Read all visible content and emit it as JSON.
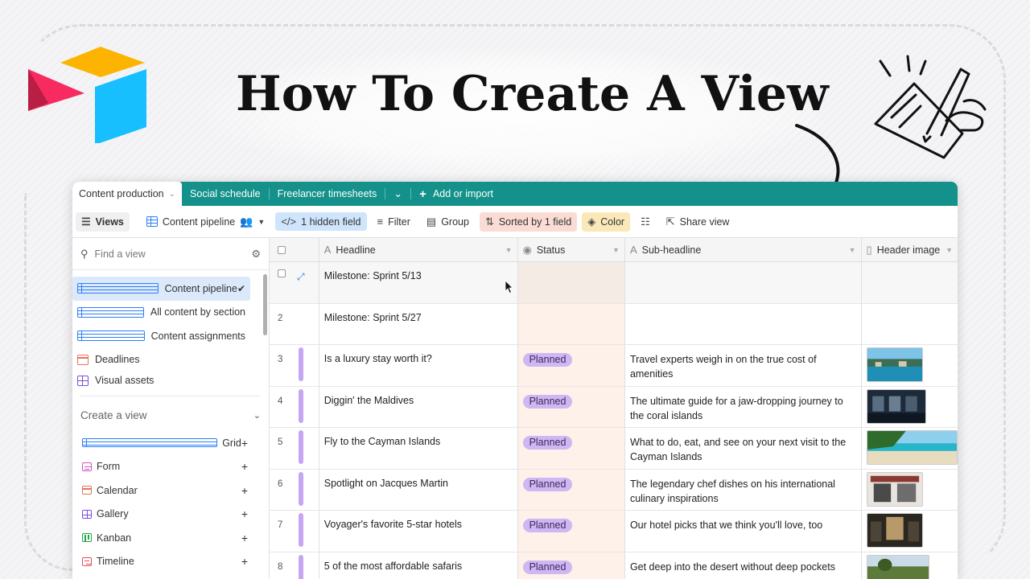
{
  "headline": "How To Create A View",
  "tabs": [
    {
      "label": "Content production",
      "active": true
    },
    {
      "label": "Social schedule",
      "active": false
    },
    {
      "label": "Freelancer timesheets",
      "active": false
    }
  ],
  "add_import_label": "Add or import",
  "toolbar": {
    "views": "Views",
    "current_view": "Content pipeline",
    "hidden": "1 hidden field",
    "filter": "Filter",
    "group": "Group",
    "sorted": "Sorted by 1 field",
    "color": "Color",
    "share": "Share view"
  },
  "sidebar": {
    "find_placeholder": "Find a view",
    "views": [
      {
        "label": "Content pipeline",
        "icon": "grid-icon"
      },
      {
        "label": "All content by section",
        "icon": "grid-icon"
      },
      {
        "label": "Content assignments",
        "icon": "grid-icon"
      },
      {
        "label": "Deadlines",
        "icon": "calendar-icon"
      },
      {
        "label": "Visual assets",
        "icon": "gallery-icon"
      }
    ],
    "create_label": "Create a view",
    "create_items": [
      {
        "label": "Grid",
        "icon": "grid-icon"
      },
      {
        "label": "Form",
        "icon": "form-icon"
      },
      {
        "label": "Calendar",
        "icon": "calendar-icon"
      },
      {
        "label": "Gallery",
        "icon": "gallery-icon"
      },
      {
        "label": "Kanban",
        "icon": "kanban-icon"
      },
      {
        "label": "Timeline",
        "icon": "timeline-icon"
      }
    ]
  },
  "columns": [
    "Headline",
    "Status",
    "Sub-headline",
    "Header image"
  ],
  "rows": [
    {
      "num": "",
      "headline": "Milestone: Sprint 5/13",
      "status": "",
      "sub": "",
      "image": ""
    },
    {
      "num": "2",
      "headline": "Milestone: Sprint 5/27",
      "status": "",
      "sub": "",
      "image": ""
    },
    {
      "num": "3",
      "headline": "Is a luxury stay worth it?",
      "status": "Planned",
      "sub": "Travel experts weigh in on the true cost of amenities",
      "image": "pool"
    },
    {
      "num": "4",
      "headline": "Diggin' the Maldives",
      "status": "Planned",
      "sub": "The ultimate guide for a jaw-dropping journey to the coral islands",
      "image": "resort"
    },
    {
      "num": "5",
      "headline": "Fly to the Cayman Islands",
      "status": "Planned",
      "sub": "What to do, eat, and see on your next visit to the Cayman Islands",
      "image": "beach"
    },
    {
      "num": "6",
      "headline": "Spotlight on Jacques Martin",
      "status": "Planned",
      "sub": "The legendary chef dishes on his international culinary inspirations",
      "image": "cafe"
    },
    {
      "num": "7",
      "headline": "Voyager's favorite 5-star hotels",
      "status": "Planned",
      "sub": "Our hotel picks that we think you'll love, too",
      "image": "lobby"
    },
    {
      "num": "8",
      "headline": "5 of the most affordable safaris",
      "status": "Planned",
      "sub": "Get deep into the desert without deep pockets",
      "image": "savanna"
    }
  ],
  "colors": {
    "teal": "#13918a",
    "status_pill": "#cfb7f3",
    "row_bar": "#c6a6f3"
  }
}
